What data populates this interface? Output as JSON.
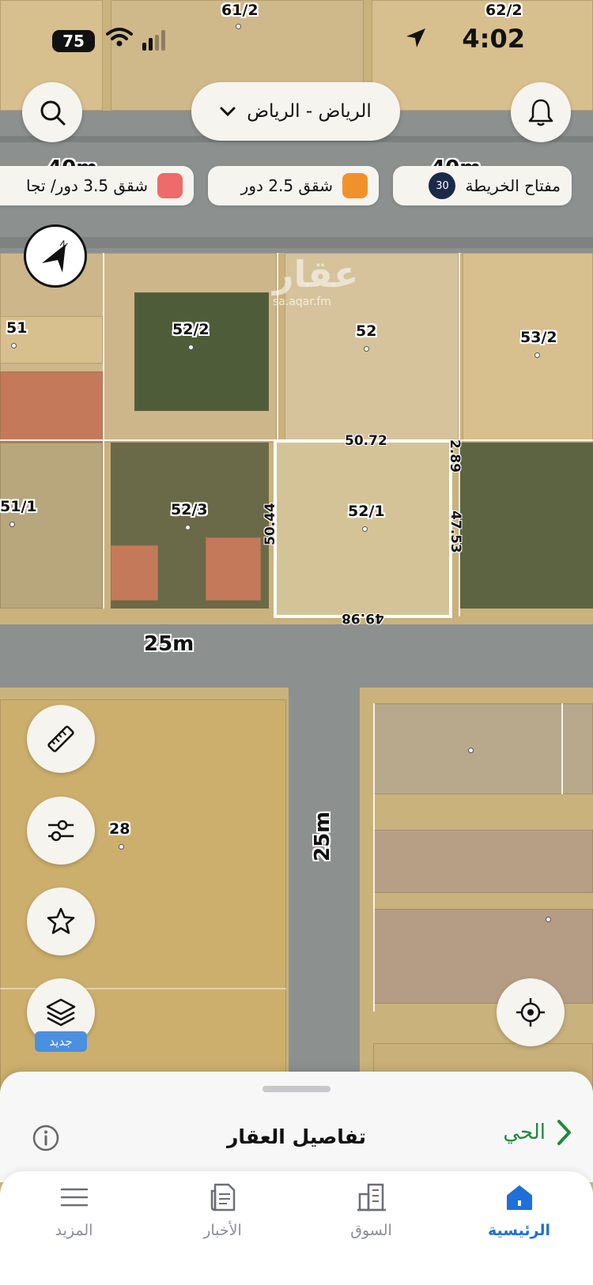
{
  "status_bar": {
    "battery": "75",
    "time": "4:02"
  },
  "top_bar": {
    "city": "الرياض - الرياض"
  },
  "chips": [
    {
      "label": "مفتاح الخريطة",
      "badge": "30"
    },
    {
      "label": "شقق 2.5 دور",
      "color": "#f0922b"
    },
    {
      "label": "شقق 3.5 دور/ تجا",
      "color": "#ef6a6a"
    }
  ],
  "map": {
    "watermark": "عقار",
    "watermark_url": "sa.aqar.fm",
    "parcels": [
      "61/2",
      "62/2",
      "51",
      "52/2",
      "52",
      "53/2",
      "51/1",
      "52/3",
      "52/1",
      "28"
    ],
    "dimensions": {
      "top": "50.72",
      "right_top": "2.89",
      "left": "50.44",
      "right": "47.53",
      "bottom": "49.98"
    },
    "roads": {
      "north_left": "40m",
      "north_right": "40m",
      "south": "25m",
      "vertical": "25m"
    }
  },
  "fabs": {
    "new_badge": "جديد"
  },
  "sheet": {
    "title": "تفاصيل العقار",
    "neighborhood": "الحي"
  },
  "tabs": [
    {
      "label": "الرئيسية",
      "active": true
    },
    {
      "label": "السوق",
      "active": false
    },
    {
      "label": "الأخبار",
      "active": false
    },
    {
      "label": "المزيد",
      "active": false
    }
  ]
}
